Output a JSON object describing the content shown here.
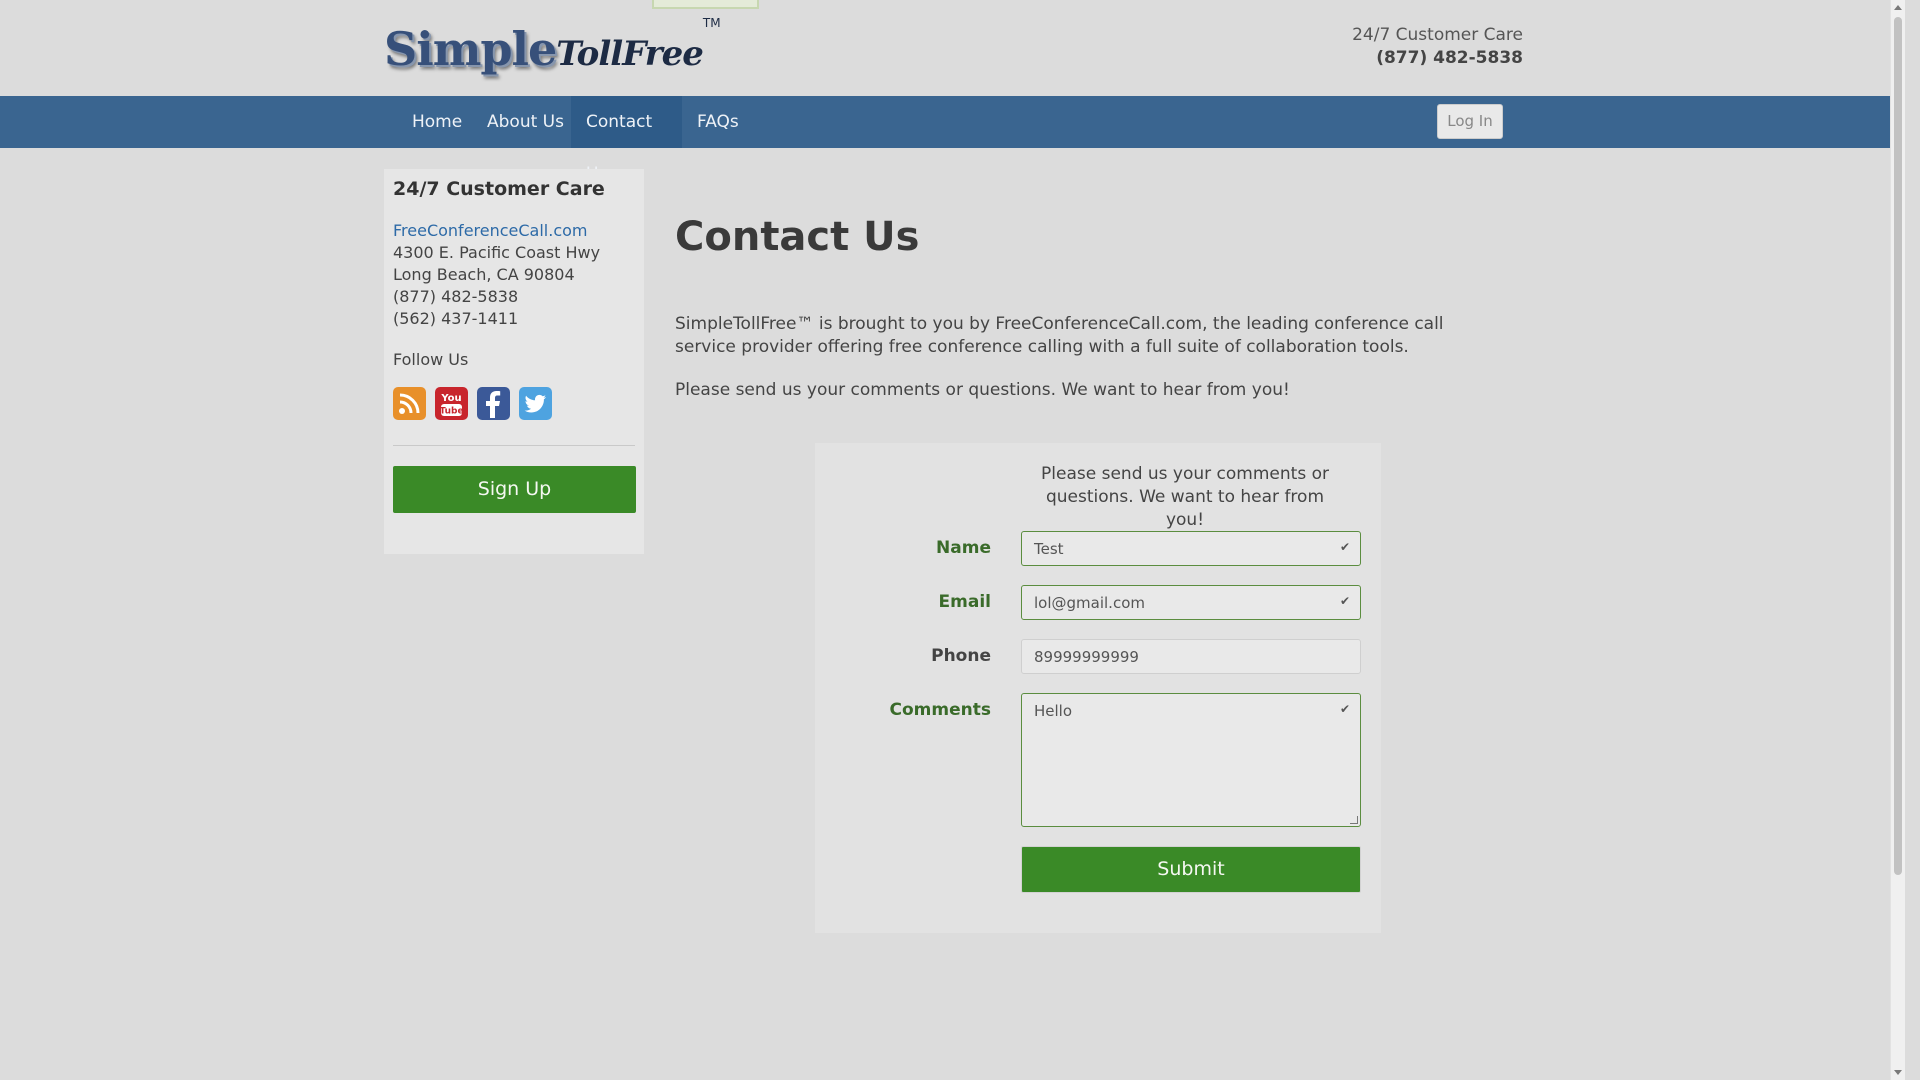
{
  "header": {
    "logo_simple": "Simple",
    "logo_tollfree": "TollFree",
    "logo_tm": "TM",
    "care_label": "24/7 Customer Care",
    "care_phone": "(877) 482-5838"
  },
  "nav": {
    "items": [
      {
        "label": "Home"
      },
      {
        "label": "About Us"
      },
      {
        "label": "Contact Us",
        "active": true
      },
      {
        "label": "FAQs"
      }
    ],
    "login_label": "Log In"
  },
  "sidebar": {
    "title": "24/7 Customer Care",
    "link": "FreeConferenceCall.com",
    "address1": "4300 E. Pacific Coast Hwy",
    "address2": "Long Beach, CA 90804",
    "phone1": "(877) 482-5838",
    "phone2": "(562) 437-1411",
    "follow": "Follow Us",
    "social": [
      "rss-icon",
      "youtube-icon",
      "facebook-icon",
      "twitter-icon"
    ],
    "signup_label": "Sign Up"
  },
  "main": {
    "title": "Contact Us",
    "intro": "SimpleTollFree™ is brought to you by FreeConferenceCall.com, the leading conference call service provider offering free conference calling with a full suite of collaboration tools.",
    "intro2": "Please send us your comments or questions. We want to hear from you!"
  },
  "form": {
    "intro": "Please send us your comments or questions. We want to hear from you!",
    "name_label": "Name",
    "name_value": "Test",
    "email_label": "Email",
    "email_value": "lol@gmail.com",
    "phone_label": "Phone",
    "phone_value": "89999999999",
    "comments_label": "Comments",
    "comments_value": "Hello",
    "submit_label": "Submit"
  },
  "colors": {
    "nav": "#3a6590",
    "nav_active": "#2e5b88",
    "green": "#3a8a27",
    "link": "#2d6aa7"
  }
}
